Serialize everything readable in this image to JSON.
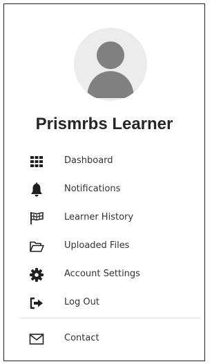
{
  "profile": {
    "name": "Prismrbs Learner",
    "avatar_icon": "default-user-avatar",
    "avatar_bg": "#ececec",
    "avatar_fg": "#808080"
  },
  "menu": {
    "items": [
      {
        "label": "Dashboard",
        "icon": "grid-icon"
      },
      {
        "label": "Notifications",
        "icon": "bell-icon"
      },
      {
        "label": "Learner History",
        "icon": "flag-icon"
      },
      {
        "label": "Uploaded Files",
        "icon": "folder-open-icon"
      },
      {
        "label": "Account Settings",
        "icon": "gear-icon"
      },
      {
        "label": "Log Out",
        "icon": "sign-out-icon"
      }
    ],
    "footer": [
      {
        "label": "Contact",
        "icon": "envelope-icon"
      }
    ]
  }
}
